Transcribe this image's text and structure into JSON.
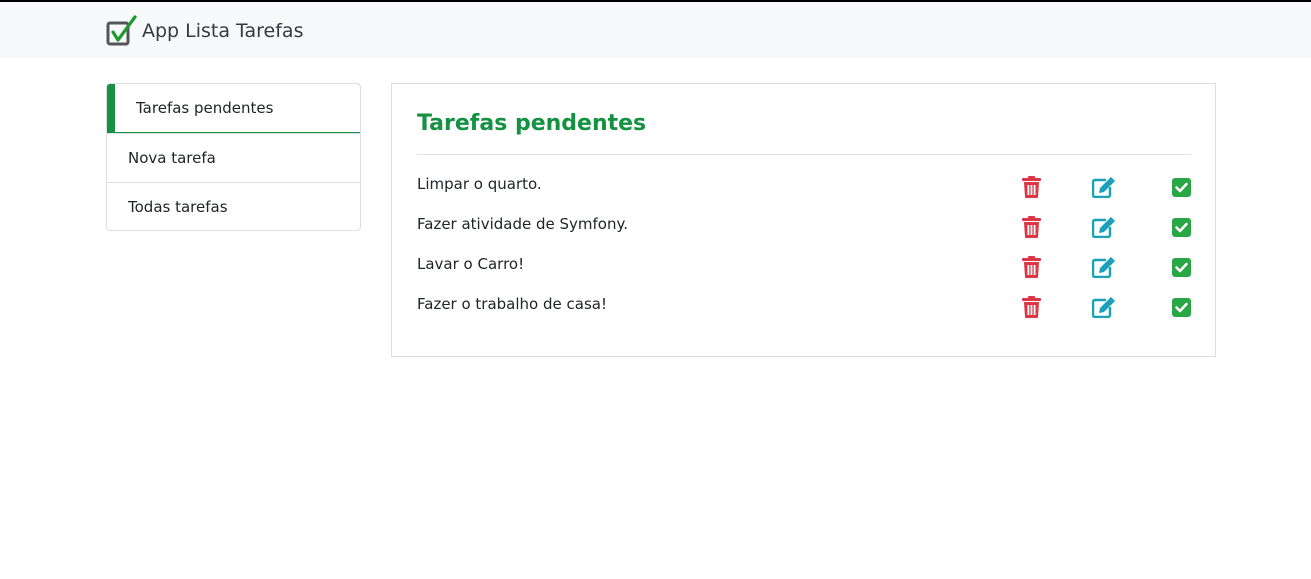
{
  "app": {
    "title": "App Lista Tarefas"
  },
  "sidebar": {
    "items": [
      {
        "label": "Tarefas pendentes",
        "active": true
      },
      {
        "label": "Nova tarefa",
        "active": false
      },
      {
        "label": "Todas tarefas",
        "active": false
      }
    ]
  },
  "main": {
    "title": "Tarefas pendentes",
    "tasks": [
      {
        "text": "Limpar o quarto."
      },
      {
        "text": "Fazer atividade de Symfony."
      },
      {
        "text": "Lavar o Carro!"
      },
      {
        "text": "Fazer o trabalho de casa!"
      }
    ],
    "actions": {
      "delete_icon": "trash-icon",
      "edit_icon": "edit-icon",
      "done_icon": "check-square-icon"
    }
  },
  "colors": {
    "brand_green": "#159142",
    "delete_red": "#dc3545",
    "edit_teal": "#17a2b8",
    "done_green": "#28a745",
    "navbar_bg": "#f8f9fa"
  }
}
